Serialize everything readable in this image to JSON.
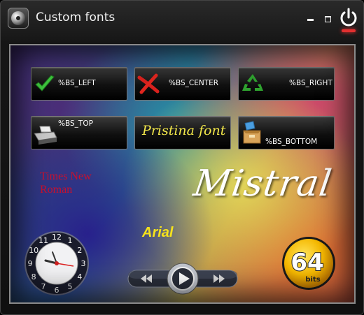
{
  "window": {
    "title": "Custom fonts",
    "icons": {
      "app": "app-disc-icon",
      "minimize": "minimize-icon",
      "maximize": "maximize-icon",
      "close": "power-icon"
    }
  },
  "buttons": [
    {
      "label": "%BS_LEFT",
      "icon": "checkmark-icon"
    },
    {
      "label": "%BS_CENTER",
      "icon": "x-mark-icon"
    },
    {
      "label": "%BS_RIGHT",
      "icon": "recycle-icon"
    },
    {
      "label": "%BS_TOP",
      "icon": "printer-icon"
    },
    {
      "label": "Pristina font",
      "icon": ""
    },
    {
      "label": "%BS_BOTTOM",
      "icon": "box-icon"
    }
  ],
  "labels": {
    "times_new_roman": "Times New Roman",
    "mistral": "Mistral",
    "arial": "Arial"
  },
  "clock": {
    "numbers": [
      "12",
      "1",
      "2",
      "3",
      "4",
      "5",
      "6",
      "7",
      "8",
      "9",
      "10",
      "11"
    ],
    "visible_numbers": [
      "12",
      "3",
      "6",
      "9"
    ]
  },
  "player": {
    "icons": [
      "rewind-icon",
      "play-icon",
      "fast-forward-icon"
    ]
  },
  "badge": {
    "number": "64",
    "text": "bits"
  },
  "colors": {
    "times": "#c8102e",
    "arial": "#f5e21c",
    "pristina": "#f3e84a",
    "power_glow": "#e23030"
  }
}
